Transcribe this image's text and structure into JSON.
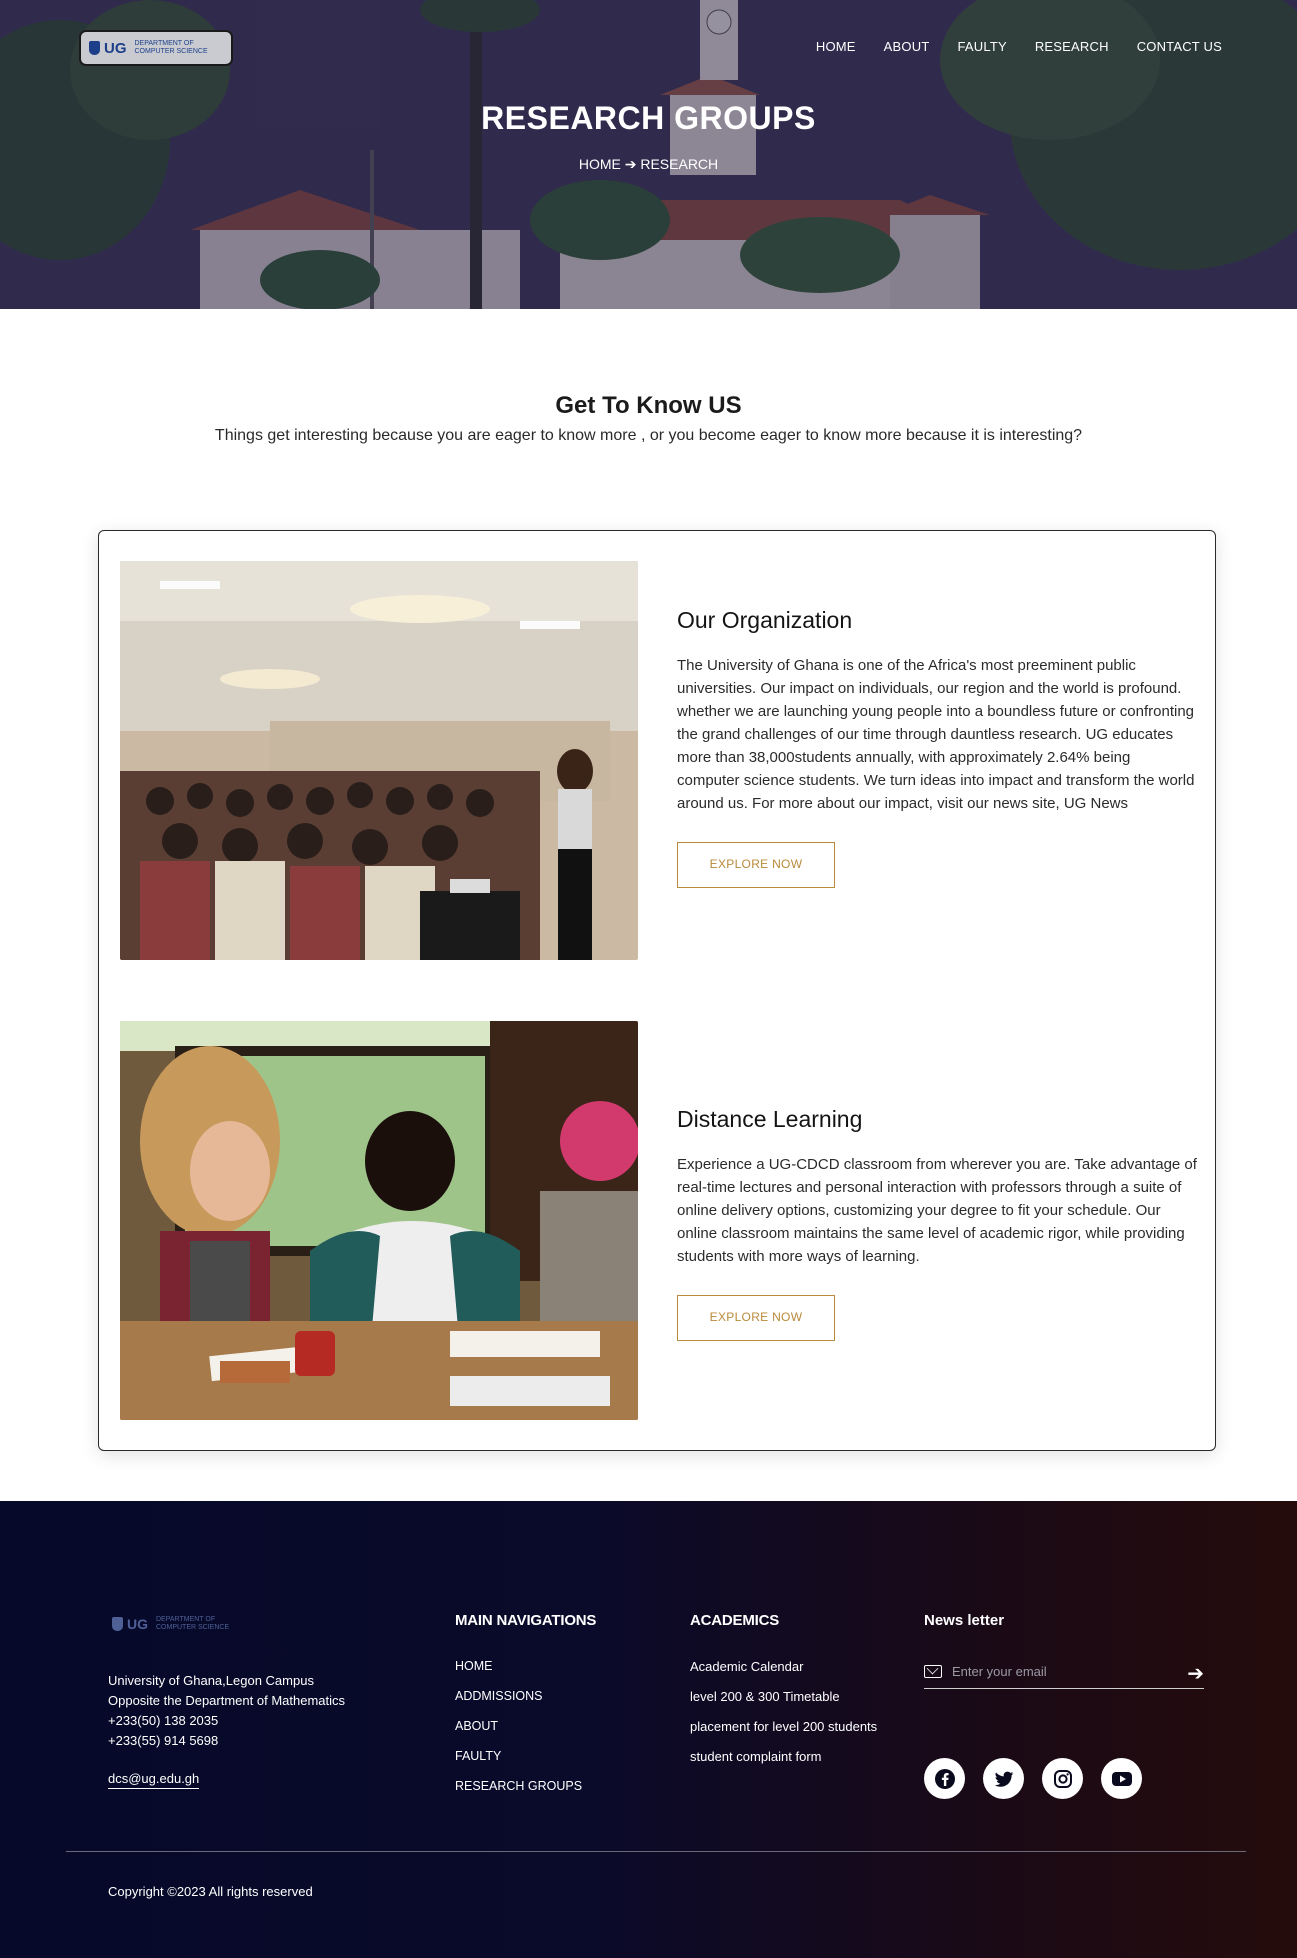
{
  "header": {
    "logo": {
      "abbr": "UG",
      "line1": "DEPARTMENT OF",
      "line2": "COMPUTER SCIENCE"
    },
    "nav": [
      "HOME",
      "ABOUT",
      "FAULTY",
      "RESEARCH",
      "CONTACT US"
    ],
    "title": "RESEARCH GROUPS",
    "breadcrumb": {
      "home": "HOME",
      "arrow": "➔",
      "current": "RESEARCH"
    }
  },
  "intro": {
    "title": "Get To Know US",
    "subtitle": "Things get interesting because you are eager to know more , or you become eager to know more because it is interesting?"
  },
  "sections": [
    {
      "title": "Our Organization",
      "body": "The University of Ghana is one of the Africa's most preeminent public universities. Our impact on individuals, our region and the world is profound. whether we are launching young people into a boundless future or confronting the grand challenges of our time through dauntless research. UG educates more than 38,000students annually, with approximately 2.64% being computer science students. We turn ideas into impact and transform the world around us. For more about our impact, visit our news site, UG News",
      "button": "EXPLORE NOW"
    },
    {
      "title": "Distance Learning",
      "body": "Experience a UG-CDCD classroom from wherever you are. Take advantage of real-time lectures and personal interaction with professors through a suite of online delivery options, customizing your degree to fit your schedule. Our online classroom maintains the same level of academic rigor, while providing students with more ways of learning.",
      "button": "EXPLORE NOW"
    }
  ],
  "footer": {
    "logo": {
      "abbr": "UG",
      "line1": "DEPARTMENT OF",
      "line2": "COMPUTER SCIENCE"
    },
    "address": [
      "University of Ghana,Legon Campus",
      "Opposite the Department of Mathematics",
      "+233(50) 138 2035",
      "+233(55) 914 5698"
    ],
    "email": "dcs@ug.edu.gh",
    "main_nav": {
      "title": "MAIN NAVIGATIONS",
      "links": [
        "HOME",
        "ADDMISSIONS",
        "ABOUT",
        "FAULTY",
        "RESEARCH GROUPS"
      ]
    },
    "academics": {
      "title": "ACADEMICS",
      "links": [
        "Academic Calendar",
        "level 200 & 300 Timetable",
        "placement for level 200 students",
        "student complaint form"
      ]
    },
    "newsletter": {
      "title": "News letter",
      "placeholder": "Enter your email",
      "submit_icon": "arrow-right-icon"
    },
    "socials": [
      "facebook-icon",
      "twitter-icon",
      "instagram-icon",
      "youtube-icon"
    ],
    "copyright": "Copyright ©2023 All rights reserved"
  },
  "colors": {
    "accent": "#b88a3b",
    "footer_start": "#06092a",
    "footer_end": "#250c0c",
    "hero_overlay": "#261e46"
  }
}
